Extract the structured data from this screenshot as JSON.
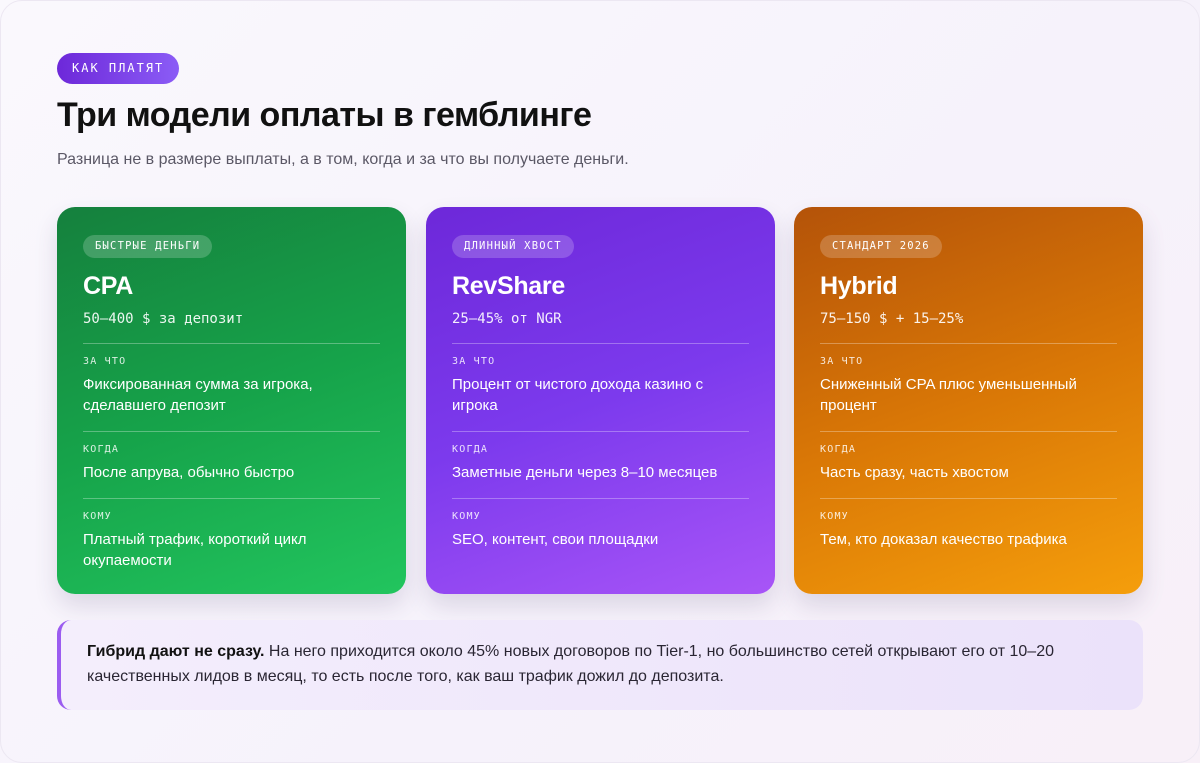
{
  "header": {
    "eyebrow": "Как платят",
    "title": "Три модели оплаты в гемблинге",
    "subtitle": "Разница не в размере выплаты, а в том, когда и за что вы получаете деньги."
  },
  "cards": [
    {
      "tag": "Быстрые деньги",
      "name": "CPA",
      "price": "50–400 $ за депозит",
      "color": "#16a34a",
      "sections": [
        {
          "label": "За что",
          "text": "Фиксированная сумма за игрока, сделавшего депозит"
        },
        {
          "label": "Когда",
          "text": "После апрува, обычно быстро"
        },
        {
          "label": "Кому",
          "text": "Платный трафик, короткий цикл окупаемости"
        }
      ]
    },
    {
      "tag": "Длинный хвост",
      "name": "RevShare",
      "price": "25–45% от NGR",
      "color": "#7c3aed",
      "sections": [
        {
          "label": "За что",
          "text": "Процент от чистого дохода казино с игрока"
        },
        {
          "label": "Когда",
          "text": "Заметные деньги через 8–10 месяцев"
        },
        {
          "label": "Кому",
          "text": "SEO, контент, свои площадки"
        }
      ]
    },
    {
      "tag": "Стандарт 2026",
      "name": "Hybrid",
      "price": "75–150 $ + 15–25%",
      "color": "#d97706",
      "sections": [
        {
          "label": "За что",
          "text": "Сниженный CPA плюс уменьшенный процент"
        },
        {
          "label": "Когда",
          "text": "Часть сразу, часть хвостом"
        },
        {
          "label": "Кому",
          "text": "Тем, кто доказал качество трафика"
        }
      ]
    }
  ],
  "callout": {
    "bold": "Гибрид дают не сразу.",
    "text": " На него приходится около 45% новых договоров по Tier-1, но большинство сетей открывают его от 10–20 качественных лидов в месяц, то есть после того, как ваш трафик дожил до депозита.",
    "accent": "#9b5cf0"
  }
}
